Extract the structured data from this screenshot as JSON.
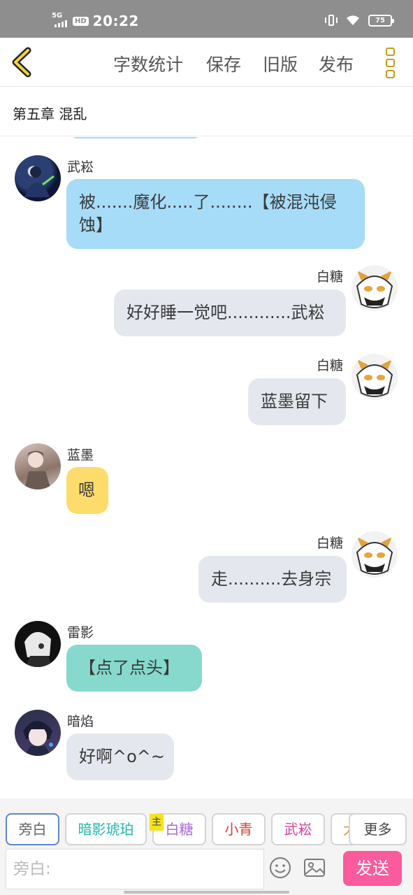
{
  "status_bar": {
    "network": "5G",
    "hd": "HD",
    "time": "20:22",
    "battery": "75"
  },
  "header": {
    "back_icon": "chevron-left-icon",
    "word_count": "字数统计",
    "save": "保存",
    "old_version": "旧版",
    "publish": "发布",
    "menu_icon": "menu-icon"
  },
  "chapter": {
    "title": "第五章 混乱"
  },
  "messages": [
    {
      "side": "left",
      "name": "武崧",
      "text": "被.......魔化.....了........【被混沌侵蚀】",
      "color": "blue"
    },
    {
      "side": "right",
      "name": "白糖",
      "text": "好好睡一觉吧............武崧",
      "color": "gray"
    },
    {
      "side": "right",
      "name": "白糖",
      "text": "蓝墨留下",
      "color": "gray"
    },
    {
      "side": "left",
      "name": "蓝墨",
      "text": "嗯",
      "color": "yellow"
    },
    {
      "side": "right",
      "name": "白糖",
      "text": "走..........去身宗",
      "color": "gray"
    },
    {
      "side": "left",
      "name": "雷影",
      "text": "【点了点头】",
      "color": "teal"
    },
    {
      "side": "left",
      "name": "暗焰",
      "text": "好啊^o^~",
      "color": "gray"
    }
  ],
  "roles": [
    {
      "label": "旁白",
      "color": "#666666"
    },
    {
      "label": "暗影琥珀",
      "color": "#25b7ad"
    },
    {
      "label": "白糖",
      "color": "#a86ad0"
    },
    {
      "label": "小青",
      "color": "#d2413a"
    },
    {
      "label": "武崧",
      "color": "#d4449a"
    },
    {
      "label": "大",
      "color": "#e58c2a"
    }
  ],
  "owner_tag": "主",
  "more_button": "更多",
  "composer": {
    "placeholder": "旁白:",
    "send": "发送",
    "emoji_icon": "emoji-icon",
    "image_icon": "image-icon"
  },
  "colors": {
    "bubble_blue": "#a6dcf8",
    "bubble_gray": "#e4e8ee",
    "bubble_yellow": "#fddc6b",
    "bubble_teal": "#86d9cc",
    "send": "#f95b9c",
    "accent": "#c79c1c"
  }
}
